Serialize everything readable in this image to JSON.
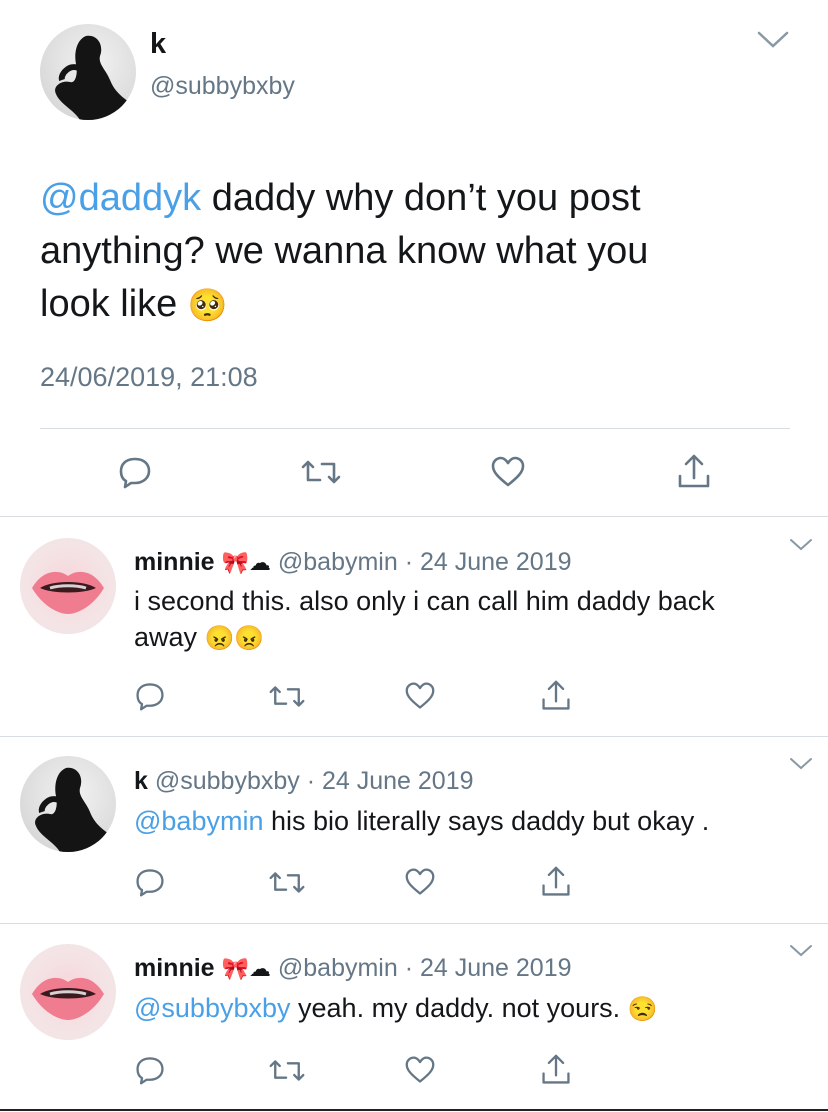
{
  "main_tweet": {
    "display_name": "k",
    "handle": "@subbybxby",
    "mention": "@daddyk",
    "text_line1": "daddy why don’t you post",
    "text_line2": "anything?  we wanna know what you",
    "text_line3": "look like",
    "emoji": "🥺",
    "timestamp": "24/06/2019, 21:08"
  },
  "replies": [
    {
      "display_name": "minnie",
      "name_emoji": "🎀☁",
      "meta": "@babymin · 24 June 2019",
      "text_line1": "i second this. also only i can call him daddy back",
      "text_line2": "away",
      "emoji": "😠😠",
      "avatar": "lips"
    },
    {
      "display_name": "k",
      "meta": "@subbybxby · 24 June 2019",
      "mention": "@babymin",
      "text": "his bio literally says daddy but okay .",
      "avatar": "dark"
    },
    {
      "display_name": "minnie",
      "name_emoji": "🎀☁",
      "meta": "@babymin · 24 June 2019",
      "mention": "@subbybxby",
      "text": "yeah. my daddy. not yours.",
      "emoji": "😒",
      "avatar": "lips"
    }
  ],
  "icons": {
    "reply": "reply-icon",
    "retweet": "retweet-icon",
    "like": "heart-icon",
    "share": "share-icon",
    "more": "chevron-down-icon"
  },
  "colors": {
    "mention": "#4aa0e6",
    "muted": "#657786",
    "icon": "#657786",
    "divider": "#d7dde2"
  }
}
